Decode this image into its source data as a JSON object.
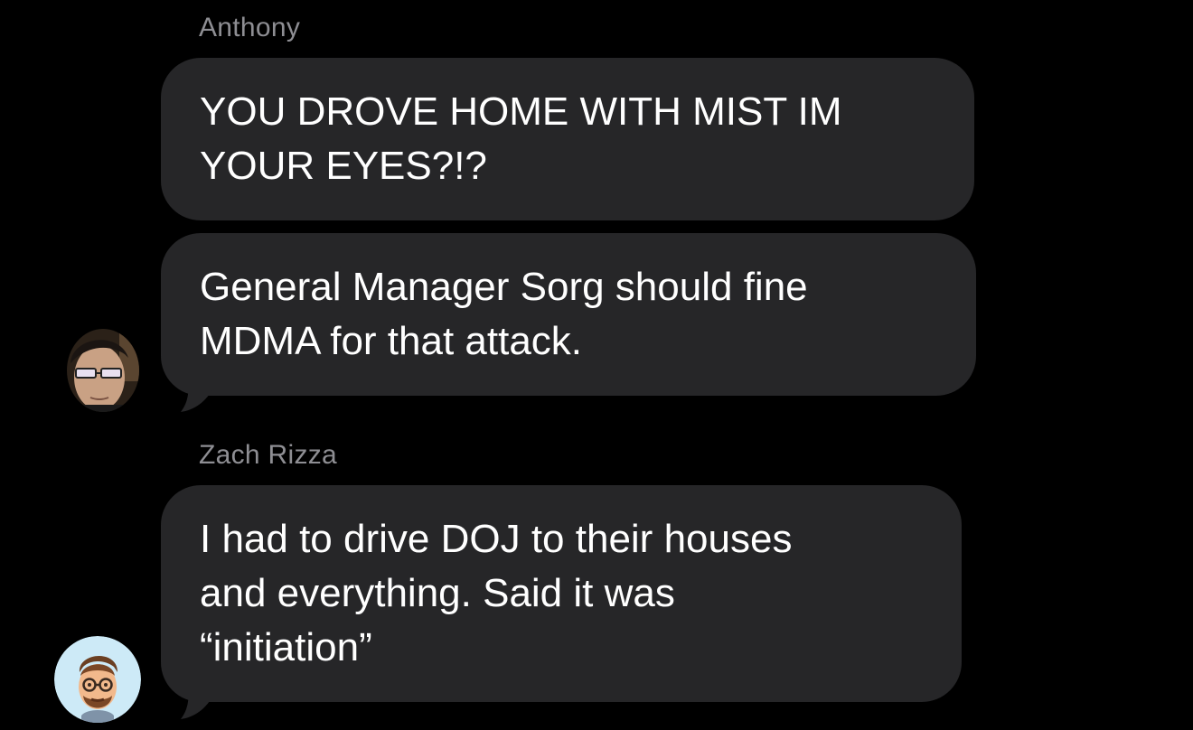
{
  "messages_group_1": {
    "sender": "Anthony",
    "messages": [
      "YOU DROVE HOME WITH MIST IM\nYOUR EYES?!?",
      "General Manager Sorg should fine\nMDMA for that attack."
    ],
    "avatar_icon": "person-photo-avatar"
  },
  "messages_group_2": {
    "sender": "Zach Rizza",
    "messages": [
      "I had to drive DOJ to their houses\nand everything. Said it was\n“initiation”"
    ],
    "avatar_icon": "memoji-avatar"
  },
  "colors": {
    "background": "#000000",
    "bubble": "#262628",
    "sender_name": "#8e8e93",
    "message_text": "#ffffff"
  }
}
